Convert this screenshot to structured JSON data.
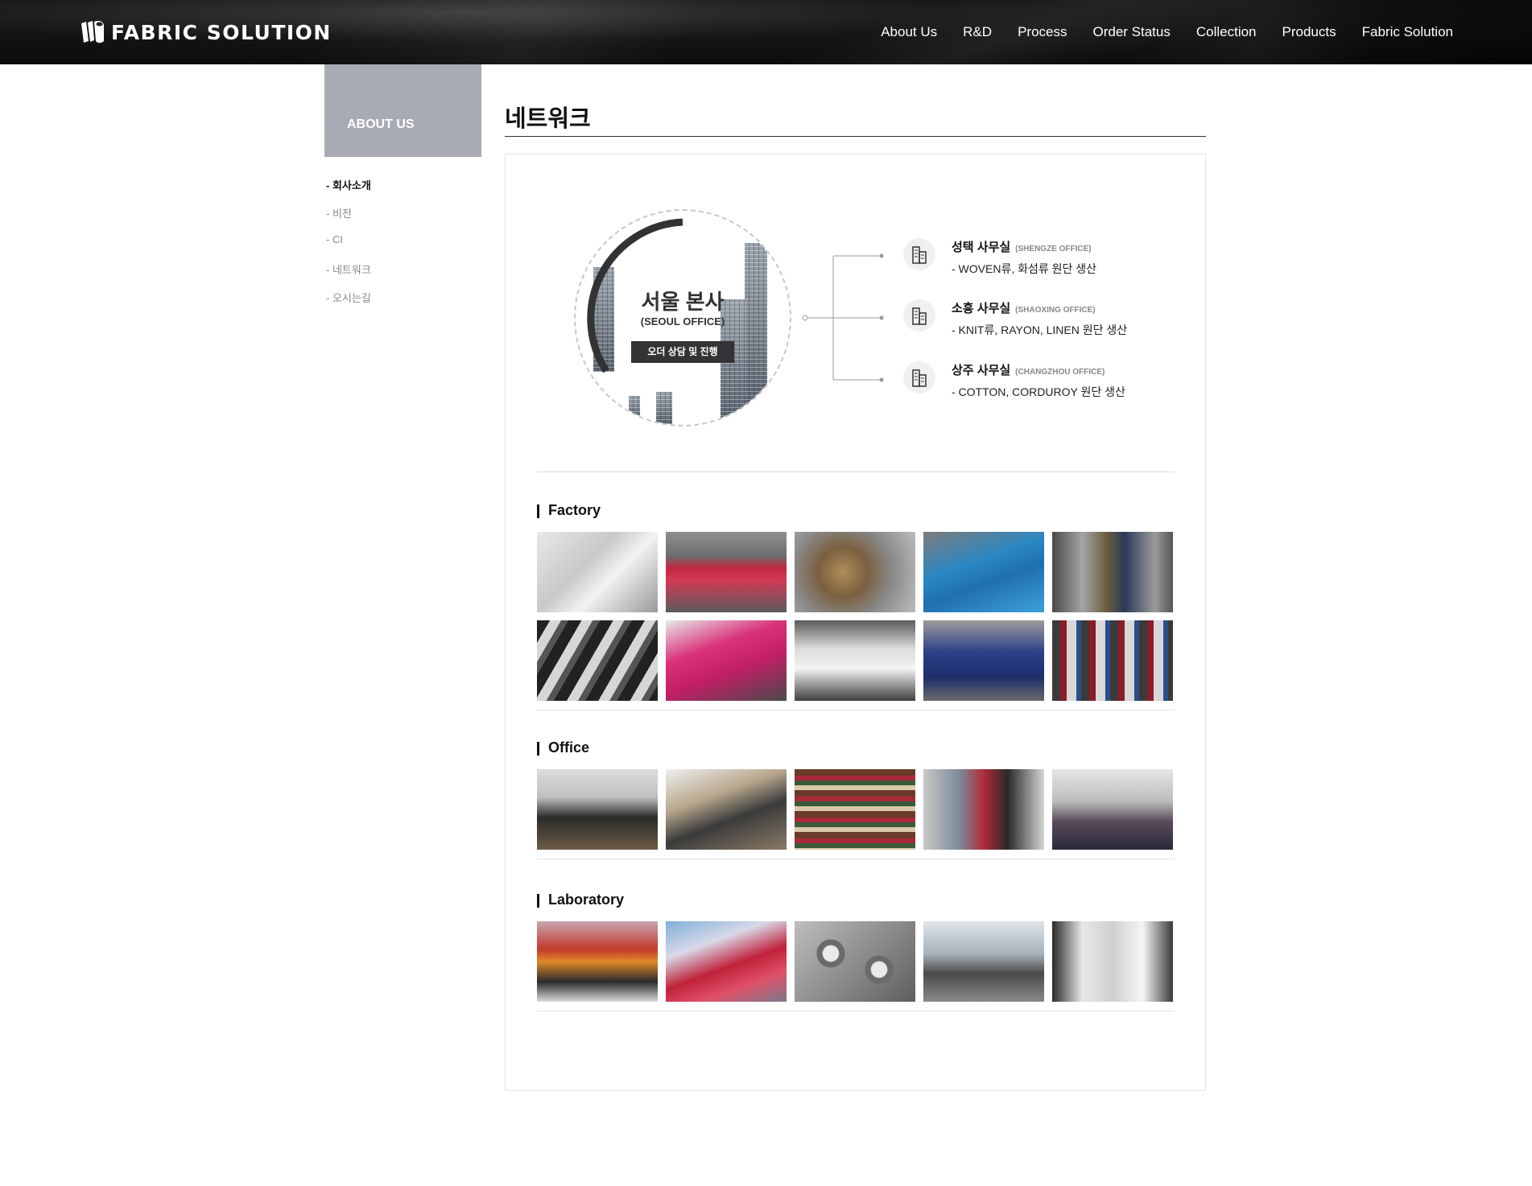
{
  "header": {
    "logo_text": "FABRIC SOLUTION",
    "nav": [
      "About Us",
      "R&D",
      "Process",
      "Order Status",
      "Collection",
      "Products",
      "Fabric Solution"
    ]
  },
  "sidebar": {
    "title": "ABOUT US",
    "items": [
      "- 회사소개",
      "- 비전",
      "- CI",
      "- 네트워크",
      "- 오시는길"
    ],
    "active_index": 0
  },
  "main": {
    "title": "네트워크",
    "hq": {
      "name": "서울 본사",
      "sub": "(SEOUL OFFICE)",
      "badge": "오더 상담 및 진행"
    },
    "offices": [
      {
        "name": "성택 사무실",
        "en": "(SHENGZE OFFICE)",
        "desc": "- WOVEN류, 화섬류 원단 생산",
        "icon": "building-icon"
      },
      {
        "name": "소흥 사무실",
        "en": "(SHAOXING OFFICE)",
        "desc": "- KNIT류, RAYON, LINEN 원단 생산",
        "icon": "building-icon"
      },
      {
        "name": "상주 사무실",
        "en": "(CHANGZHOU OFFICE)",
        "desc": "- COTTON, CORDUROY 원단 생산",
        "icon": "building-icon"
      }
    ],
    "sections": {
      "factory": "Factory",
      "office": "Office",
      "laboratory": "Laboratory"
    }
  },
  "colors": {
    "header_bg": "#0d0d0d",
    "sidebar_title_bg": "#a9abb4",
    "accent_dark": "#333333"
  }
}
